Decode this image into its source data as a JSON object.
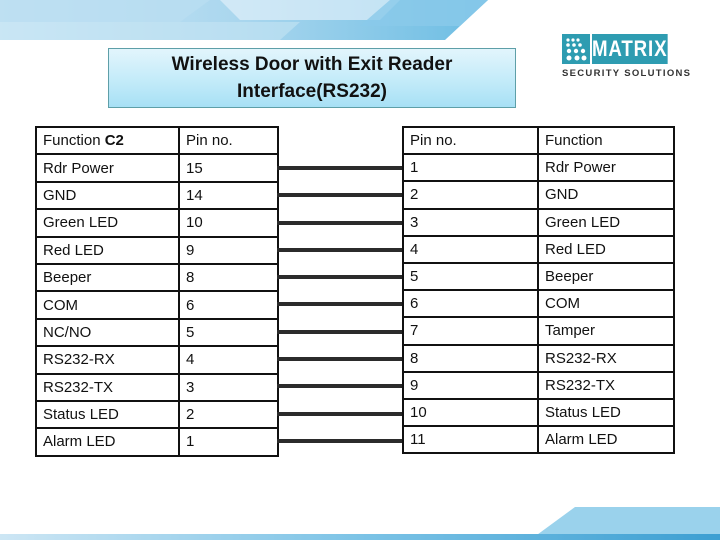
{
  "title": {
    "line1": "Wireless Door with Exit Reader",
    "line2": "Interface(RS232)"
  },
  "logo": {
    "brand": "MATRIX",
    "tagline": "SECURITY SOLUTIONS",
    "icon": "dot-grid-icon",
    "color": "#2e9cb1"
  },
  "left_table": {
    "headers": {
      "function_prefix": "Function ",
      "function_bold": "C2",
      "pin": "Pin no."
    },
    "rows": [
      {
        "function": "Rdr Power",
        "pin": "15"
      },
      {
        "function": "GND",
        "pin": "14"
      },
      {
        "function": "Green LED",
        "pin": "10"
      },
      {
        "function": "Red LED",
        "pin": "9"
      },
      {
        "function": "Beeper",
        "pin": "8"
      },
      {
        "function": "COM",
        "pin": "6"
      },
      {
        "function": "NC/NO",
        "pin": "5"
      },
      {
        "function": "RS232-RX",
        "pin": "4"
      },
      {
        "function": "RS232-TX",
        "pin": "3"
      },
      {
        "function": "Status LED",
        "pin": "2"
      },
      {
        "function": "Alarm LED",
        "pin": "1"
      }
    ]
  },
  "right_table": {
    "headers": {
      "pin": "Pin no.",
      "function": "Function"
    },
    "rows": [
      {
        "pin": "1",
        "function": "Rdr Power"
      },
      {
        "pin": "2",
        "function": "GND"
      },
      {
        "pin": "3",
        "function": "Green LED"
      },
      {
        "pin": "4",
        "function": "Red LED"
      },
      {
        "pin": "5",
        "function": "Beeper"
      },
      {
        "pin": "6",
        "function": "COM"
      },
      {
        "pin": "7",
        "function": "Tamper"
      },
      {
        "pin": "8",
        "function": "RS232-RX"
      },
      {
        "pin": "9",
        "function": "RS232-TX"
      },
      {
        "pin": "10",
        "function": "Status LED"
      },
      {
        "pin": "11",
        "function": "Alarm LED"
      }
    ]
  },
  "connections": 11,
  "colors": {
    "title_border": "#5e9fa8",
    "title_fill_top": "#e2f5fc",
    "title_fill_bottom": "#a7e0f5",
    "wire": "#2b2b2b",
    "deco_blue": "#5db6e0"
  }
}
